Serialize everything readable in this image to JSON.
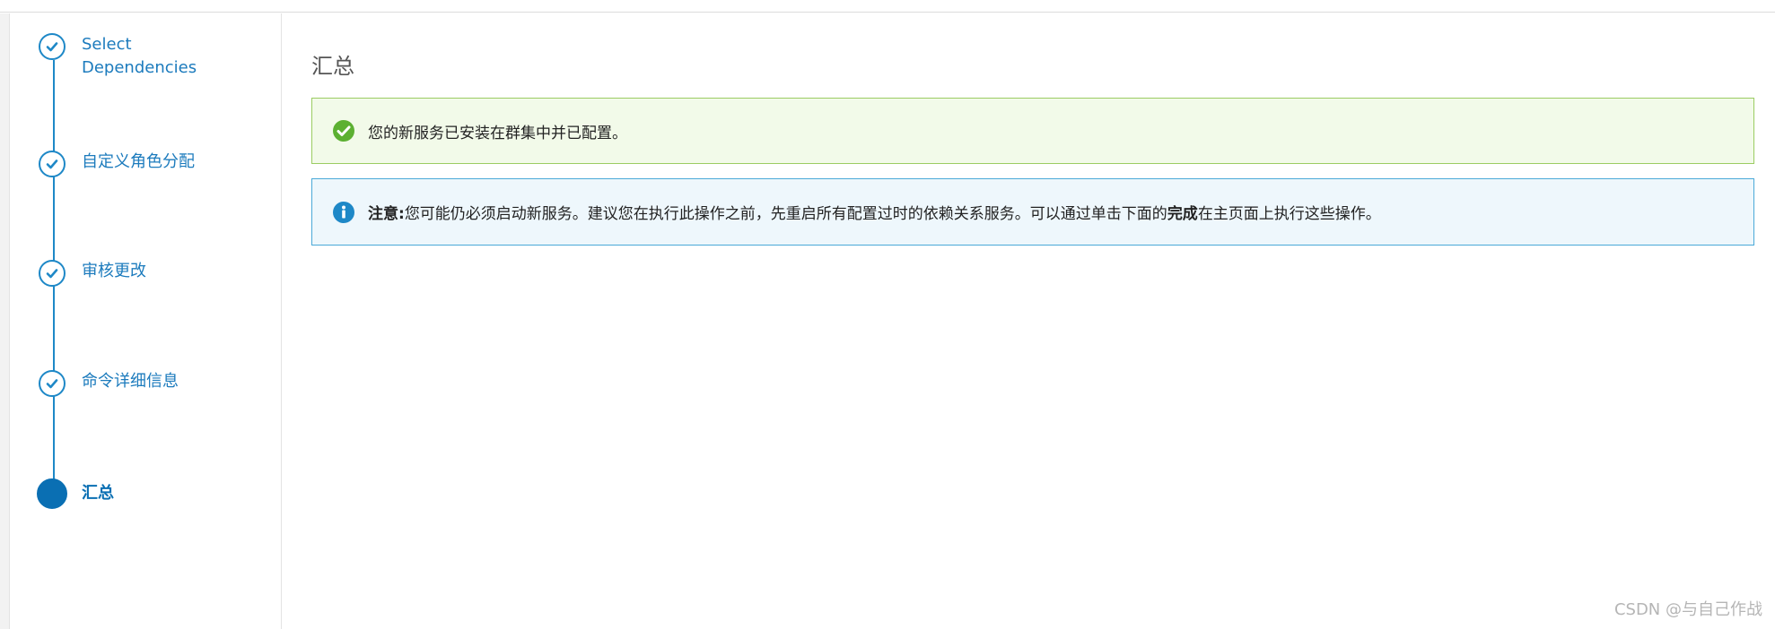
{
  "steps": [
    {
      "label_line1": "Select",
      "label_line2": "Dependencies",
      "state": "complete",
      "icon": "check-icon"
    },
    {
      "label": "自定义角色分配",
      "state": "complete",
      "icon": "check-icon"
    },
    {
      "label": "审核更改",
      "state": "complete",
      "icon": "check-icon"
    },
    {
      "label": "命令详细信息",
      "state": "complete",
      "icon": "check-icon"
    },
    {
      "label": "汇总",
      "state": "current",
      "icon": "current-step-dot"
    }
  ],
  "main": {
    "title": "汇总",
    "success_alert": {
      "icon": "check-circle-icon",
      "text": "您的新服务已安装在群集中并已配置。"
    },
    "info_alert": {
      "icon": "info-circle-icon",
      "label": "注意:",
      "text_before": "您可能仍必须启动新服务。建议您在执行此操作之前，先重启所有配置过时的依赖关系服务。可以通过单击下面的",
      "bold": "完成",
      "text_after": "在主页面上执行这些操作。"
    }
  },
  "watermark": "CSDN @与自己作战",
  "colors": {
    "accent": "#1e88c7",
    "current": "#0a6fb3",
    "success_bg": "#f2fae9",
    "success_border": "#9bcc62",
    "success_icon": "#5cb032",
    "info_bg": "#eef7fc",
    "info_border": "#4aa9d8",
    "info_icon": "#1e88c7"
  }
}
